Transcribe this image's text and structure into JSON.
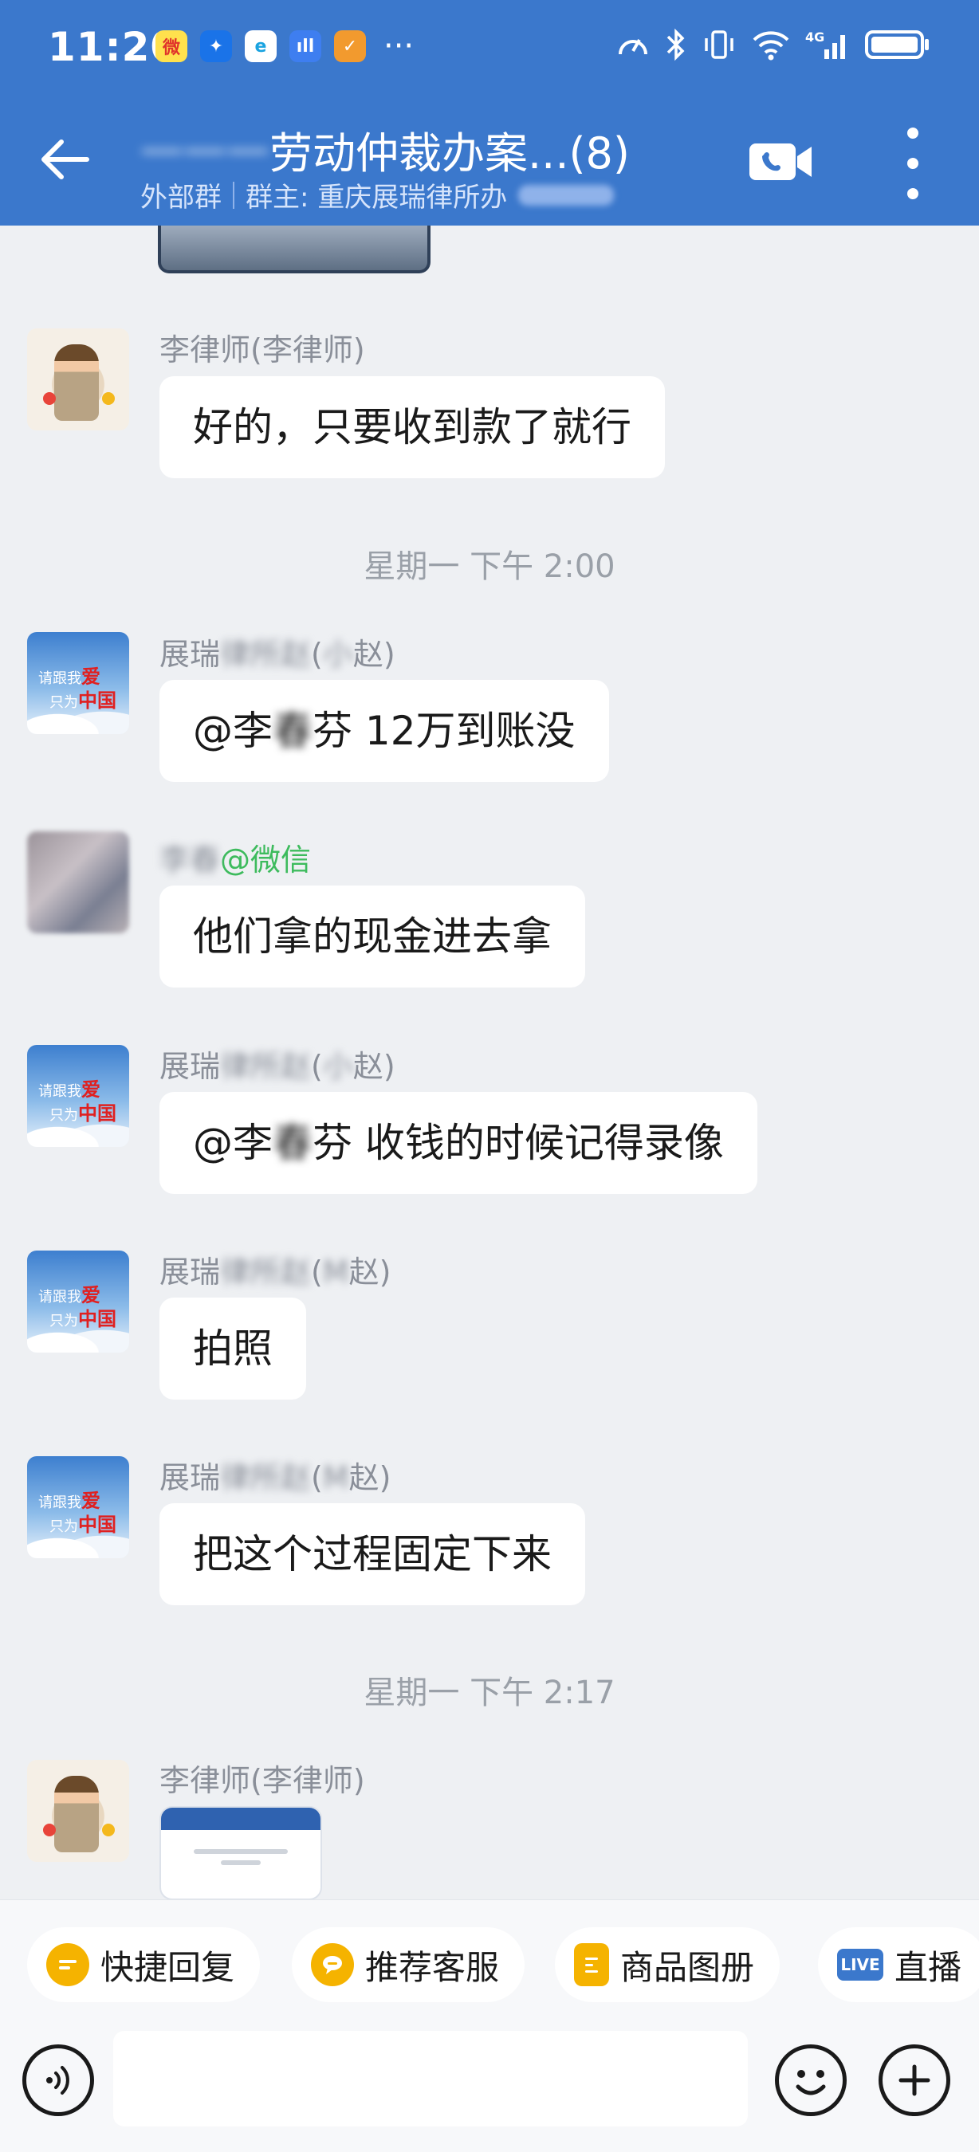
{
  "status_bar": {
    "time": "11:20",
    "app_icons": [
      "weibo-icon",
      "tie-icon",
      "edge-browser-icon",
      "audio-icon",
      "check-app-icon"
    ],
    "more": "···",
    "network": "4G"
  },
  "header": {
    "title_prefix": "一一一",
    "title": "劳动仲裁办案...(8)",
    "tag": "外部群",
    "owner": "群主: 重庆展瑞律所办"
  },
  "messages": [
    {
      "sender": "李律师(李律师)",
      "text": "好的，只要收到款了就行"
    },
    {
      "timestamp": "星期一  下午 2:00"
    },
    {
      "sender_prefix": "展瑞",
      "sender_blur": "律所赵",
      "sender_suffix": "(",
      "sender_blur2": "小",
      "sender_end": "赵)",
      "mention": "@李",
      "mention_blur": "春",
      "mention_end": "芬",
      "text": "  12万到账没"
    },
    {
      "sender_blur": "李春",
      "sender_wx": "@微信",
      "text": "他们拿的现金进去拿"
    },
    {
      "sender_prefix": "展瑞",
      "sender_blur": "律所赵",
      "sender_suffix": "(",
      "sender_blur2": "小",
      "sender_end": "赵)",
      "mention": "@李",
      "mention_blur": "春",
      "mention_end": "芬",
      "text": "  收钱的时候记得录像"
    },
    {
      "sender_prefix": "展瑞",
      "sender_blur": "律所赵",
      "sender_suffix": "(",
      "sender_blur2": "M",
      "sender_end": "赵)",
      "text": "拍照"
    },
    {
      "sender_prefix": "展瑞",
      "sender_blur": "律所赵",
      "sender_suffix": "(",
      "sender_blur2": "M",
      "sender_end": "赵)",
      "text": "把这个过程固定下来"
    },
    {
      "timestamp": "星期一  下午 2:17"
    },
    {
      "sender": "李律师(李律师)",
      "image": true
    }
  ],
  "quick_replies": [
    {
      "label": "快捷回复",
      "icon": "quick-reply-icon"
    },
    {
      "label": "推荐客服",
      "icon": "service-icon"
    },
    {
      "label": "商品图册",
      "icon": "catalog-icon"
    },
    {
      "label": "直播",
      "icon": "live-icon",
      "badge": "LIVE"
    }
  ],
  "input": {
    "placeholder": ""
  },
  "colors": {
    "header": "#3b78cc",
    "background": "#eef0f3",
    "bubble": "#ffffff",
    "wechat_green": "#3dbb5d"
  }
}
